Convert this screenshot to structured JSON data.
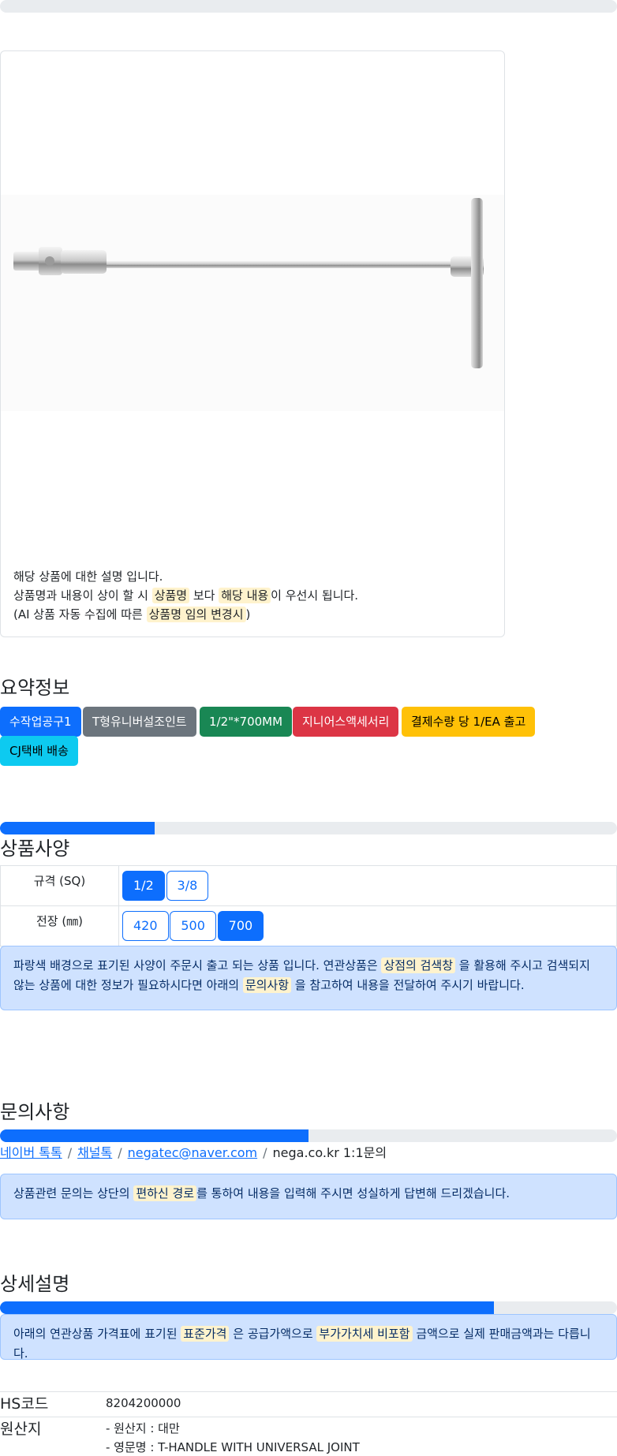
{
  "description": {
    "line1": "해당 상품에 대한 설명 입니다.",
    "line2_pre": "상품명과 내용이 상이 할 시 ",
    "line2_hl1": "상품명",
    "line2_mid": " 보다 ",
    "line2_hl2": "해당 내용",
    "line2_post": "이 우선시 됩니다.",
    "line3_pre": "(AI 상품 자동 수집에 따른 ",
    "line3_hl": "상품명 임의 변경시",
    "line3_post": ")"
  },
  "summary": {
    "title": "요약정보",
    "badges": [
      {
        "label": "수작업공구1",
        "color": "#0d6efd"
      },
      {
        "label": "T형유니버설조인트",
        "color": "#6c757d"
      },
      {
        "label": "1/2\"*700MM",
        "color": "#198754"
      },
      {
        "label": "지니어스액세서리",
        "color": "#dc3545"
      },
      {
        "label": "결제수량 당 1/EA 출고",
        "color": "#ffc107"
      },
      {
        "label": "CJ택배 배송",
        "color": "#0dcaf0"
      }
    ]
  },
  "spec": {
    "title": "상품사양",
    "progress": 0.25,
    "rows": [
      {
        "label": "규격 (SQ)",
        "options": [
          "1/2",
          "3/8"
        ],
        "selected": "1/2"
      },
      {
        "label": "전장 (㎜)",
        "options": [
          "420",
          "500",
          "700"
        ],
        "selected": "700"
      }
    ],
    "notice_pre": "파랑색 배경으로 표기된 사양이 주문시 출고 되는 상품 입니다. 연관상품은 ",
    "notice_hl1": "상점의 검색창",
    "notice_mid": " 을 활용해 주시고 검색되지 않는 상품에 대한 정보가 필요하시다면 아래의 ",
    "notice_hl2": "문의사항",
    "notice_post": " 을 참고하여 내용을 전달하여 주시기 바랍니다."
  },
  "inquiry": {
    "title": "문의사항",
    "progress": 0.5,
    "links": [
      "네이버 톡톡",
      "채널톡",
      "negatec@naver.com"
    ],
    "plain": "nega.co.kr 1:1문의",
    "notice_pre": "상품관련 문의는 상단의 ",
    "notice_hl": "편하신 경로",
    "notice_post": "를 통하여 내용을 입력해 주시면 성실하게 답변해 드리겠습니다."
  },
  "detail": {
    "title": "상세설명",
    "progress": 0.8,
    "notice_pre": "아래의 연관상품 가격표에 표기된 ",
    "notice_hl1": "표준가격",
    "notice_mid": " 은 공급가액으로 ",
    "notice_hl2": "부가가치세 비포함",
    "notice_post": " 금액으로 실제 판매금액과는 다릅니다."
  },
  "info": {
    "hs_label": "HS코드",
    "hs_value": "8204200000",
    "origin_label": "원산지",
    "origin_line1": "- 원산지 : 대만",
    "origin_line2": "- 영문명 : T-HANDLE WITH UNIVERSAL JOINT"
  }
}
